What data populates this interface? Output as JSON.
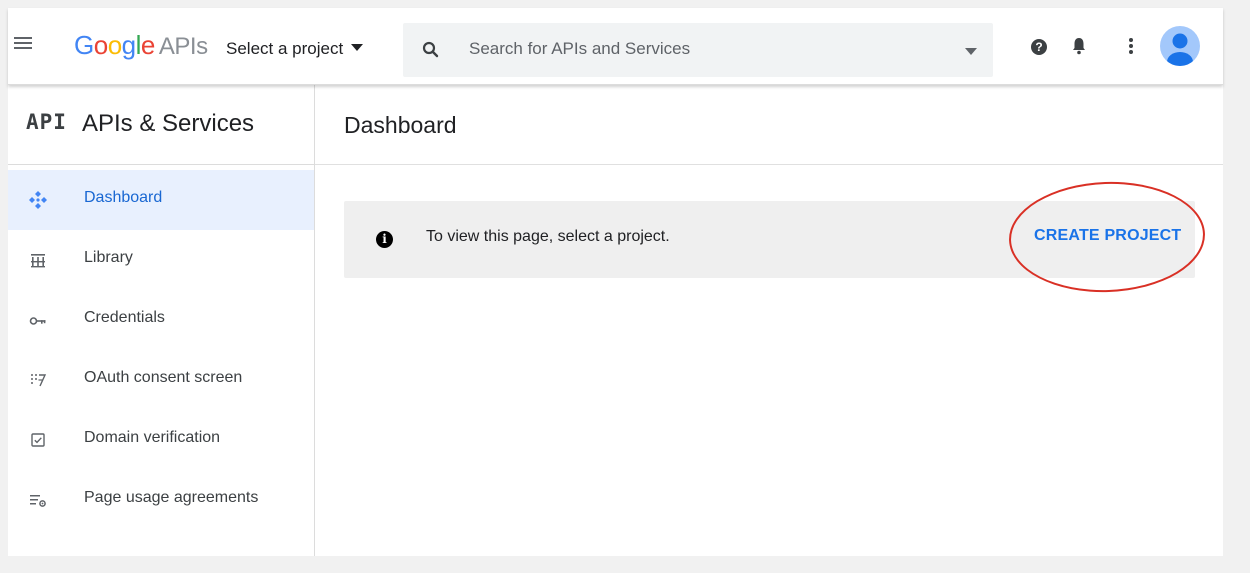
{
  "header": {
    "logo_google": "Google",
    "logo_apis": "APIs",
    "project_select_label": "Select a project",
    "search_placeholder": "Search for APIs and Services"
  },
  "sidebar": {
    "badge": "API",
    "title": "APIs & Services",
    "items": [
      {
        "label": "Dashboard",
        "icon": "dashboard-icon",
        "active": true
      },
      {
        "label": "Library",
        "icon": "library-icon",
        "active": false
      },
      {
        "label": "Credentials",
        "icon": "key-icon",
        "active": false
      },
      {
        "label": "OAuth consent screen",
        "icon": "oauth-consent-icon",
        "active": false
      },
      {
        "label": "Domain verification",
        "icon": "domain-check-icon",
        "active": false
      },
      {
        "label": "Page usage agreements",
        "icon": "settings-list-icon",
        "active": false
      }
    ]
  },
  "main": {
    "page_title": "Dashboard",
    "notice_text": "To view this page, select a project.",
    "create_project_label": "CREATE PROJECT"
  },
  "colors": {
    "accent": "#1a73e8",
    "active_bg": "#e8f0fe",
    "annotation_red": "#d93025"
  }
}
